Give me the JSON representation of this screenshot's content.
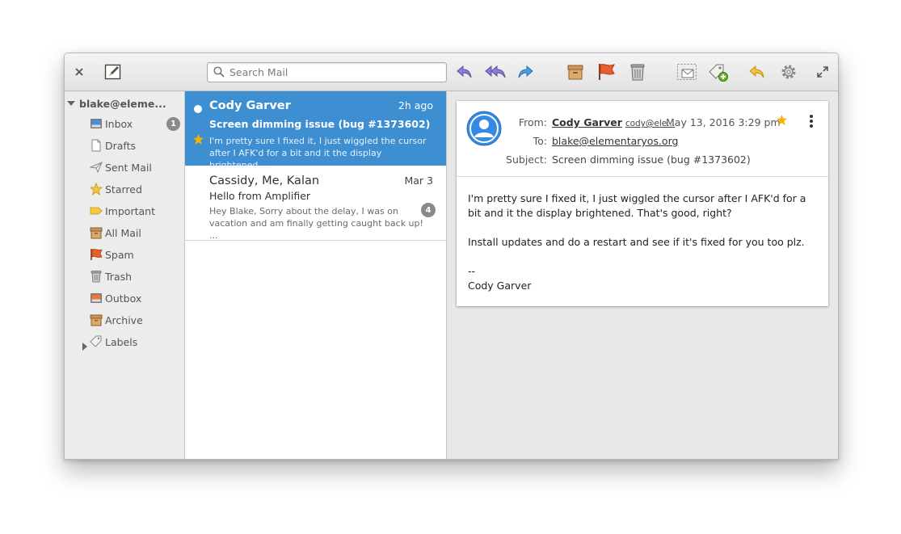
{
  "toolbar": {
    "search_placeholder": "Search Mail",
    "icons": [
      "close-icon",
      "compose-icon",
      "reply-icon",
      "reply-all-icon",
      "forward-icon",
      "archive-icon",
      "flag-icon",
      "trash-icon",
      "move-icon",
      "label-icon",
      "undo-icon",
      "settings-icon",
      "fullscreen-icon"
    ]
  },
  "sidebar": {
    "account": "blake@eleme...",
    "folders": [
      {
        "label": "Inbox",
        "icon": "inbox-icon",
        "count": "1"
      },
      {
        "label": "Drafts",
        "icon": "drafts-icon"
      },
      {
        "label": "Sent Mail",
        "icon": "sent-icon"
      },
      {
        "label": "Starred",
        "icon": "star-icon"
      },
      {
        "label": "Important",
        "icon": "important-icon"
      },
      {
        "label": "All Mail",
        "icon": "all-mail-icon"
      },
      {
        "label": "Spam",
        "icon": "spam-icon"
      },
      {
        "label": "Trash",
        "icon": "trash-icon"
      },
      {
        "label": "Outbox",
        "icon": "outbox-icon"
      },
      {
        "label": "Archive",
        "icon": "archive-icon"
      },
      {
        "label": "Labels",
        "icon": "tag-icon"
      }
    ]
  },
  "messages": [
    {
      "sender": "Cody Garver",
      "date": "2h ago",
      "subject": "Screen dimming issue (bug #1373602)",
      "preview": "I'm pretty sure I fixed it, I just wiggled the cursor after I AFK'd for a bit and it the display brightened. ...",
      "unread": true,
      "starred": true,
      "selected": true
    },
    {
      "sender": "Cassidy, Me, Kalan",
      "date": "Mar 3",
      "subject": "Hello from Amplifier",
      "preview": "Hey Blake, Sorry about the delay, I was on vacation and am finally getting caught back up! ...",
      "count": "4"
    }
  ],
  "reader": {
    "from_label": "From:",
    "from_name": "Cody Garver",
    "from_email": "cody@ele...",
    "date": "May 13, 2016 3:29 pm",
    "to_label": "To:",
    "to": "blake@elementaryos.org",
    "subject_label": "Subject:",
    "subject": "Screen dimming issue (bug #1373602)",
    "body": [
      "I'm pretty sure I fixed it, I just wiggled the cursor after I AFK'd for a bit and it the display brightened. That's good, right?",
      "Install updates and do a restart and see if it's fixed for you too plz.",
      "--",
      "Cody Garver"
    ]
  },
  "colors": {
    "selection": "#3d8fd1",
    "star": "#f4b400",
    "avatar": "#3689e6"
  }
}
